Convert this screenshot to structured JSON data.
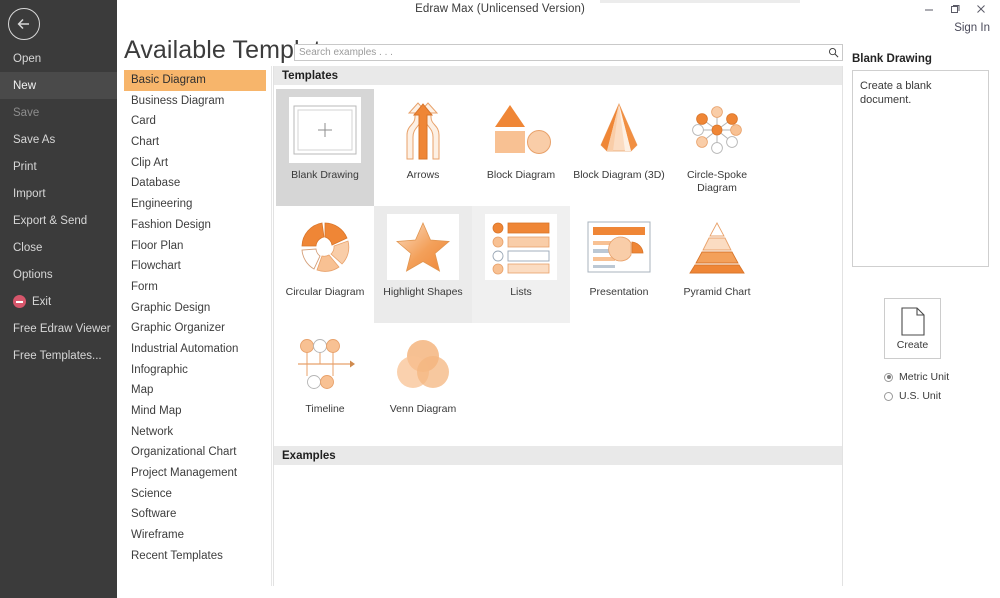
{
  "window": {
    "title": "Edraw Max (Unlicensed Version)",
    "minimize_label": "–",
    "restore_label": "❐",
    "close_label": "×",
    "sign_in_label": "Sign In"
  },
  "sidebar": {
    "back_icon": "back-arrow-icon",
    "items": [
      {
        "label": "Open",
        "state": "normal"
      },
      {
        "label": "New",
        "state": "active"
      },
      {
        "label": "Save",
        "state": "disabled"
      },
      {
        "label": "Save As",
        "state": "normal"
      },
      {
        "label": "Print",
        "state": "normal"
      },
      {
        "label": "Import",
        "state": "normal"
      },
      {
        "label": "Export & Send",
        "state": "normal"
      },
      {
        "label": "Close",
        "state": "normal"
      },
      {
        "label": "Options",
        "state": "normal"
      },
      {
        "label": "Exit",
        "state": "normal",
        "icon": "exit-icon"
      },
      {
        "label": "Free Edraw Viewer",
        "state": "normal"
      },
      {
        "label": "Free Templates...",
        "state": "normal"
      }
    ]
  },
  "header": {
    "page_title": "Available Templates"
  },
  "search": {
    "placeholder": "Search examples . . .",
    "value": "",
    "icon": "search-icon"
  },
  "categories": {
    "selected": "Basic Diagram",
    "items": [
      "Basic Diagram",
      "Business Diagram",
      "Card",
      "Chart",
      "Clip Art",
      "Database",
      "Engineering",
      "Fashion Design",
      "Floor Plan",
      "Flowchart",
      "Form",
      "Graphic Design",
      "Graphic Organizer",
      "Industrial Automation",
      "Infographic",
      "Map",
      "Mind Map",
      "Network",
      "Organizational Chart",
      "Project Management",
      "Science",
      "Software",
      "Wireframe",
      "Recent Templates"
    ]
  },
  "templates": {
    "section_label": "Templates",
    "items": [
      {
        "label": "Blank Drawing",
        "icon": "blank-page-icon",
        "state": "selected"
      },
      {
        "label": "Arrows",
        "icon": "arrows-icon",
        "state": "normal"
      },
      {
        "label": "Block Diagram",
        "icon": "block-diagram-icon",
        "state": "normal"
      },
      {
        "label": "Block Diagram (3D)",
        "icon": "block-diagram-3d-icon",
        "state": "normal"
      },
      {
        "label": "Circle-Spoke Diagram",
        "icon": "circle-spoke-icon",
        "state": "normal"
      },
      {
        "label": "Circular Diagram",
        "icon": "circular-diagram-icon",
        "state": "normal"
      },
      {
        "label": "Highlight Shapes",
        "icon": "star-icon",
        "state": "hover"
      },
      {
        "label": "Lists",
        "icon": "lists-icon",
        "state": "hover2"
      },
      {
        "label": "Presentation",
        "icon": "presentation-icon",
        "state": "normal"
      },
      {
        "label": "Pyramid Chart",
        "icon": "pyramid-icon",
        "state": "normal"
      },
      {
        "label": "Timeline",
        "icon": "timeline-icon",
        "state": "normal"
      },
      {
        "label": "Venn Diagram",
        "icon": "venn-icon",
        "state": "normal"
      }
    ]
  },
  "examples": {
    "section_label": "Examples"
  },
  "details": {
    "title": "Blank Drawing",
    "description": "Create a blank document.",
    "create_label": "Create",
    "create_icon": "document-icon",
    "units": [
      {
        "label": "Metric Unit",
        "selected": true
      },
      {
        "label": "U.S. Unit",
        "selected": false
      }
    ]
  },
  "colors": {
    "accent": "#f7b56b",
    "orange": "#ef8636",
    "orange_light": "#f6bd8b",
    "orange_pale": "#fbdcc2",
    "sidebar_bg": "#3b3b3b",
    "section_bg": "#e9e9e9"
  }
}
